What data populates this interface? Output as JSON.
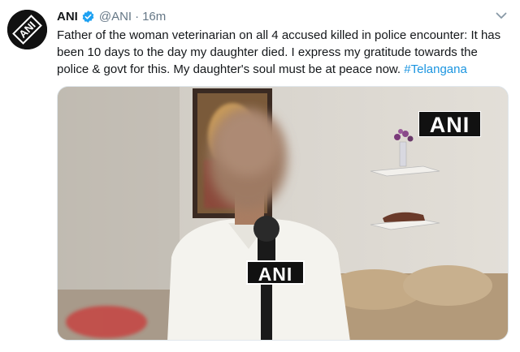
{
  "tweet": {
    "author_name": "ANI",
    "handle": "@ANI",
    "separator": "·",
    "time": "16m",
    "text_main": "Father of the woman veterinarian on all 4 accused killed in police encounter: It has been 10 days to the day my daughter died. I express my gratitude towards the police & govt for this. My daughter's soul must be at peace now.",
    "hashtag": "#Telangana",
    "avatar_logo_text": "ANI"
  },
  "media": {
    "watermark": "ANI",
    "mic_flag": "ANI"
  },
  "colors": {
    "link": "#1b95e0",
    "verified": "#1da1f2",
    "muted": "#657786"
  },
  "icons": [
    "verified-badge-icon",
    "chevron-down-icon"
  ]
}
